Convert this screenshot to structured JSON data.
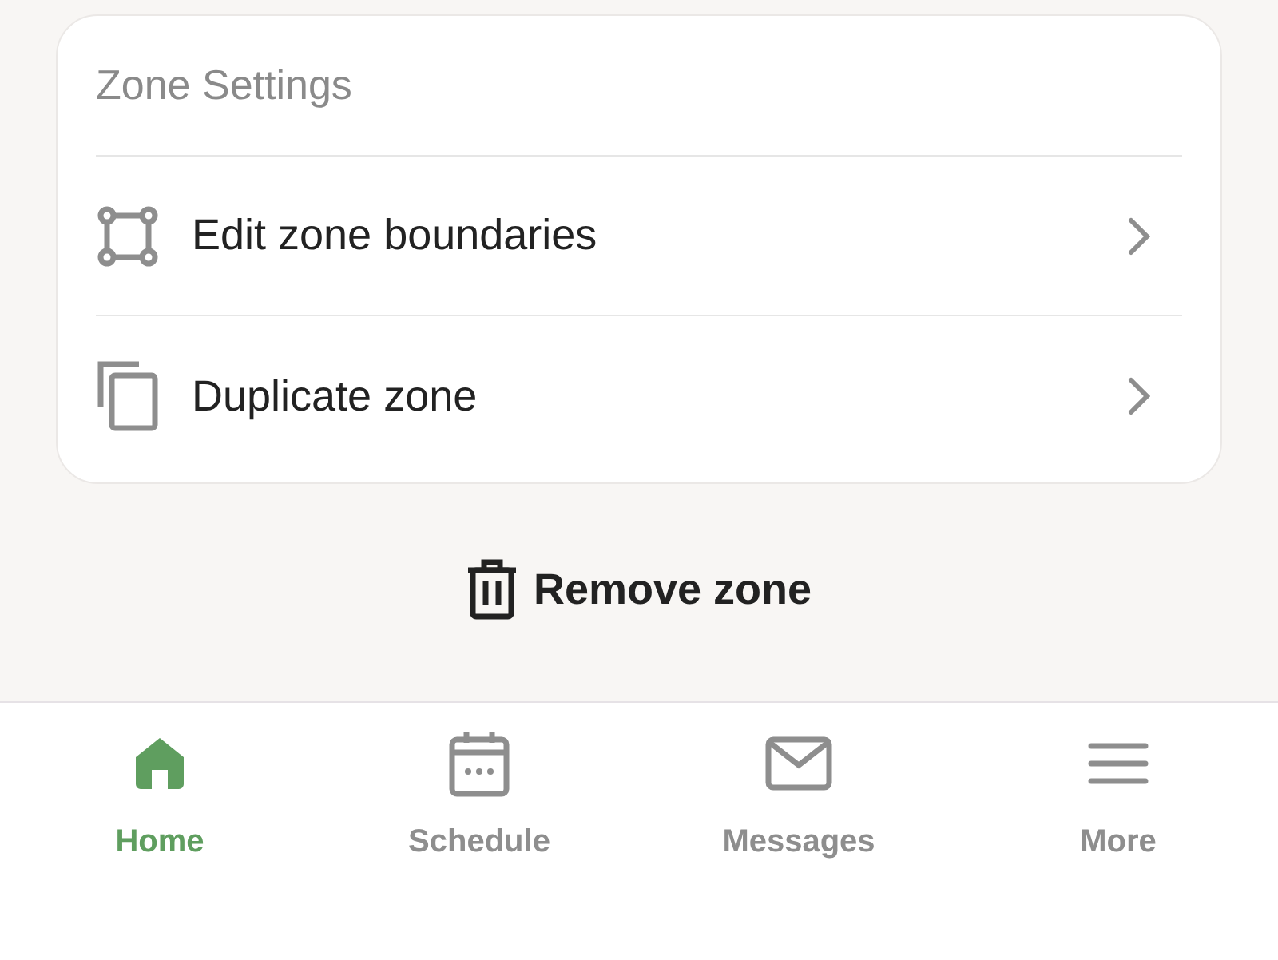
{
  "zone_settings": {
    "title": "Zone Settings",
    "items": [
      {
        "kind": "boundaries",
        "label": "Edit zone boundaries"
      },
      {
        "kind": "duplicate",
        "label": "Duplicate zone"
      }
    ]
  },
  "remove_button": {
    "label": "Remove zone"
  },
  "tab_bar": [
    {
      "kind": "home",
      "label": "Home",
      "selected": true
    },
    {
      "kind": "schedule",
      "label": "Schedule",
      "selected": false
    },
    {
      "kind": "messages",
      "label": "Messages",
      "selected": false
    },
    {
      "kind": "more",
      "label": "More",
      "selected": false
    }
  ]
}
